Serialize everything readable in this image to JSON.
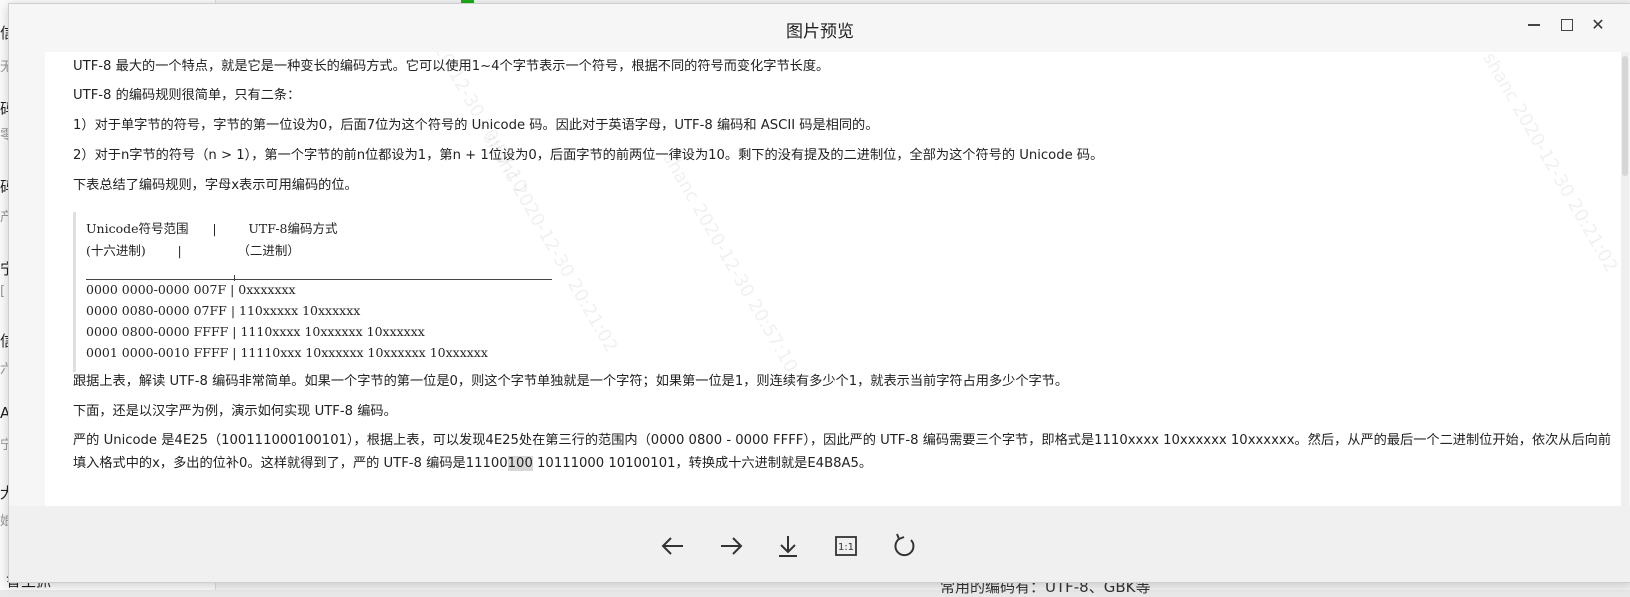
{
  "background": {
    "left_chars": [
      "信",
      "无",
      "码",
      "零",
      "码",
      "产",
      "宁",
      "[",
      "信",
      "六",
      "A",
      "宁",
      "大",
      "娘"
    ],
    "bottom_left_text": "鲁主抓",
    "bottom_right_text": "常用的编码有：UTF-8、GBK等"
  },
  "window": {
    "title": "图片预览",
    "minimize_label": "",
    "maximize_label": "",
    "close_label": "✕"
  },
  "article": {
    "p1": "UTF-8 最大的一个特点，就是它是一种变长的编码方式。它可以使用1~4个字节表示一个符号，根据不同的符号而变化字节长度。",
    "p2": "UTF-8 的编码规则很简单，只有二条：",
    "p3": "1）对于单字节的符号，字节的第一位设为0，后面7位为这个符号的 Unicode 码。因此对于英语字母，UTF-8 编码和 ASCII 码是相同的。",
    "p4": "2）对于n字节的符号（n > 1），第一个字节的前n位都设为1，第n + 1位设为0，后面字节的前两位一律设为10。剩下的没有提及的二进制位，全部为这个符号的 Unicode 码。",
    "p5": "下表总结了编码规则，字母x表示可用编码的位。",
    "table": {
      "header1": "Unicode符号范围      |        UTF-8编码方式",
      "header2": "(十六进制)        |              （二进制）",
      "rows": [
        "0000 0000-0000 007F | 0xxxxxxx",
        "0000 0080-0000 07FF | 110xxxxx 10xxxxxx",
        "0000 0800-0000 FFFF | 1110xxxx 10xxxxxx 10xxxxxx",
        "0001 0000-0010 FFFF | 11110xxx 10xxxxxx 10xxxxxx 10xxxxxx"
      ]
    },
    "p6": "跟据上表，解读 UTF-8 编码非常简单。如果一个字节的第一位是0，则这个字节单独就是一个字符；如果第一位是1，则连续有多少个1，就表示当前字符占用多少个字节。",
    "p7": "下面，还是以汉字严为例，演示如何实现 UTF-8 编码。",
    "p8_line1": "严的 Unicode 是4E25（100111000100101），根据上表，可以发现4E25处在第三行的范围内（0000 0800 - 0000 FFFF），因此严的 UTF-8 编码需要三个字节，即格式是1110xxxx 10xxxxxx 10xxxxxx。然后，从严的最后一个二进制位开始，依次从后向前",
    "p8_line2_a": "填入格式中的x，多出的位补0。这样就得到了，严的 UTF-8 编码是11100",
    "p8_line2_hl": "100",
    "p8_line2_b": " 10111000 10100101，转换成十六进制就是E4B8A5。"
  },
  "watermark": {
    "user": "shanc",
    "stamps": [
      "2020-12-30 20:57:10",
      "2020-12-30 20:21:02",
      "2020-12-30 20:57:10",
      "2020-12-30 20:21:02"
    ]
  },
  "toolbar": {
    "icons": [
      "arrow-left-icon",
      "arrow-right-icon",
      "download-icon",
      "actual-size-icon",
      "rotate-icon"
    ],
    "actual_size_label": "1:1"
  }
}
